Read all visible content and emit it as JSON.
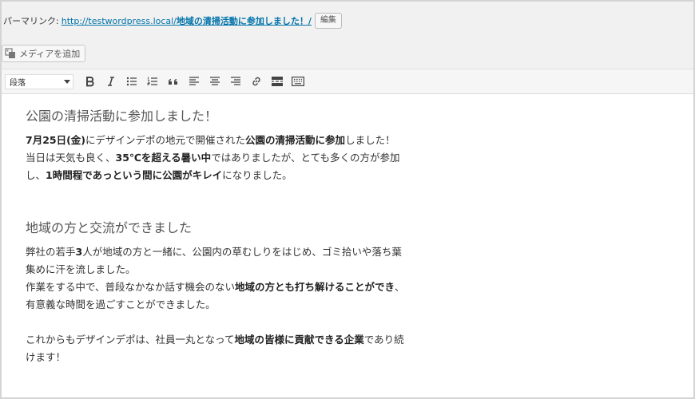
{
  "permalink": {
    "label": "パーマリンク:",
    "url_base": "http://testwordpress.local/",
    "url_slug": "地域の清掃活動に参加しました！/",
    "edit_label": "編集"
  },
  "media": {
    "add_label": "メディアを追加"
  },
  "toolbar": {
    "format_value": "段落"
  },
  "content": {
    "heading1": "公園の清掃活動に参加しました！",
    "p1": {
      "s1": "7月25日",
      "s2": "(金)",
      "s3": "にデザインデポの地元で開催された",
      "s4": "公園の清掃活動に参加",
      "s5": "しました！"
    },
    "p2": {
      "s1": "当日は天気も良く、",
      "s2": "35℃を超える暑い中",
      "s3": "ではありましたが、とても多くの方が参加し、",
      "s4": "1時間程であっという間に公園がキレイ",
      "s5": "になりました。"
    },
    "heading2": "地域の方と交流ができました",
    "p3": {
      "s1": "弊社の若手",
      "s2": "3",
      "s3": "人が地域の方と一緒に、公園内の草むしりをはじめ、ゴミ拾いや落ち葉集めに汗を流しました。"
    },
    "p4": {
      "s1": "作業をする中で、普段なかなか話す機会のない",
      "s2": "地域の方とも打ち解けることができ",
      "s3": "、有意義な時間を過ごすことができました。"
    },
    "p5": {
      "s1": "これからもデザインデポは、社員一丸となって",
      "s2": "地域の皆様に貢献できる企業",
      "s3": "であり続けます！"
    }
  }
}
